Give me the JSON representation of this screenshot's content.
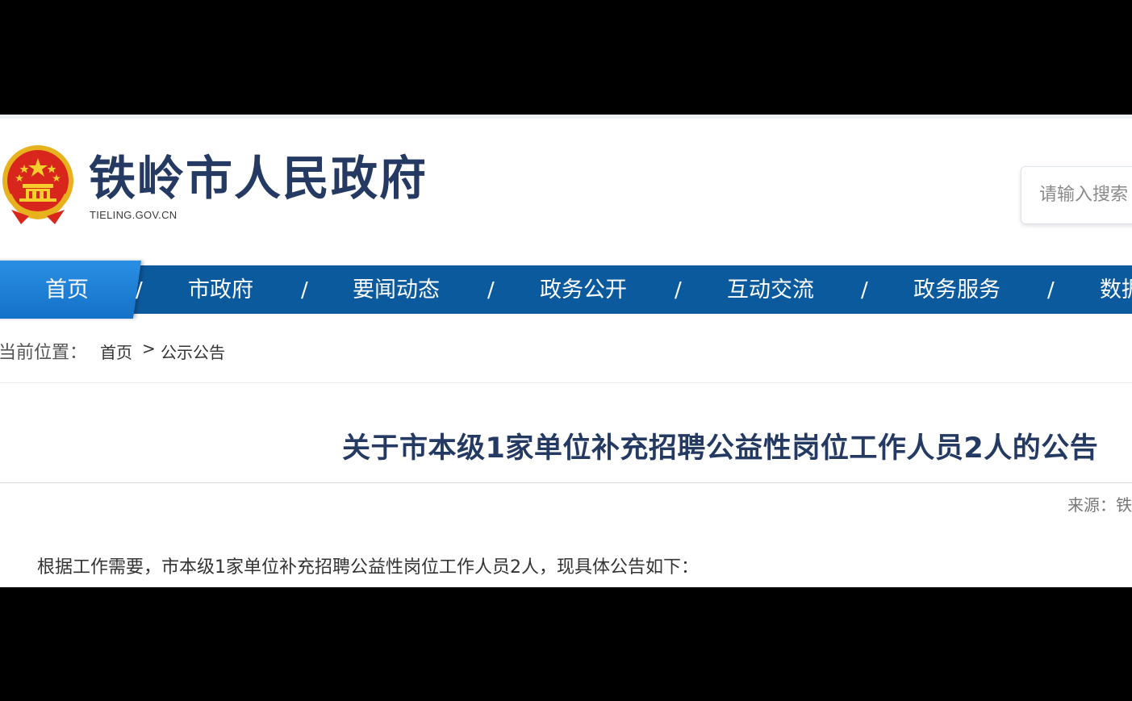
{
  "header": {
    "site_title": "铁岭市人民政府",
    "site_domain": "TIELING.GOV.CN",
    "emblem_icon": "national-emblem-icon"
  },
  "search": {
    "placeholder": "请输入搜索"
  },
  "nav": {
    "items": [
      {
        "label": "首页"
      },
      {
        "label": "市政府"
      },
      {
        "label": "要闻动态"
      },
      {
        "label": "政务公开"
      },
      {
        "label": "互动交流"
      },
      {
        "label": "政务服务"
      },
      {
        "label": "数据"
      }
    ],
    "separator": "/"
  },
  "breadcrumb": {
    "label": "当前位置：",
    "home": "首页",
    "separator": ">",
    "current": "公示公告"
  },
  "article": {
    "title": "关于市本级1家单位补充招聘公益性岗位工作人员2人的公告",
    "source": "来源：铁",
    "paragraph": "根据工作需要，市本级1家单位补充招聘公益性岗位工作人员2人，现具体公告如下："
  },
  "colors": {
    "nav_background": "#0b5a9e",
    "nav_home_active": "#1f82d8",
    "title_text": "#243a62"
  }
}
